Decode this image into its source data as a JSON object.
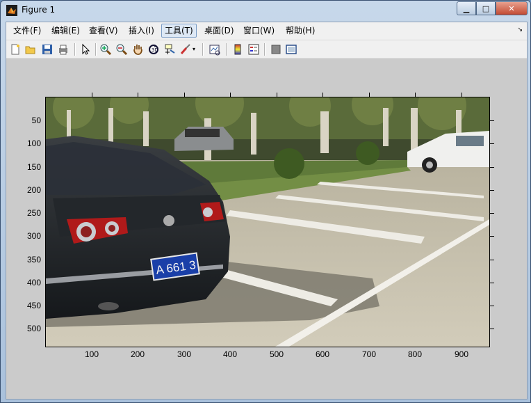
{
  "window": {
    "title": "Figure 1"
  },
  "menu": {
    "items": [
      "文件(F)",
      "编辑(E)",
      "查看(V)",
      "插入(I)",
      "工具(T)",
      "桌面(D)",
      "窗口(W)",
      "帮助(H)"
    ]
  },
  "toolbar": {
    "icons": [
      "new-figure-icon",
      "open-file-icon",
      "save-icon",
      "print-icon",
      "pointer-icon",
      "zoom-in-icon",
      "zoom-out-icon",
      "pan-icon",
      "rotate-3d-icon",
      "data-cursor-icon",
      "brush-icon",
      "link-plot-icon",
      "colorbar-icon",
      "legend-icon",
      "hide-plot-tools-icon",
      "show-plot-tools-icon"
    ]
  },
  "axes": {
    "y_ticks": [
      "50",
      "100",
      "150",
      "200",
      "250",
      "300",
      "350",
      "400",
      "450",
      "500"
    ],
    "x_ticks": [
      "100",
      "200",
      "300",
      "400",
      "500",
      "600",
      "700",
      "800",
      "900"
    ],
    "plate_text": "A 661 3"
  }
}
